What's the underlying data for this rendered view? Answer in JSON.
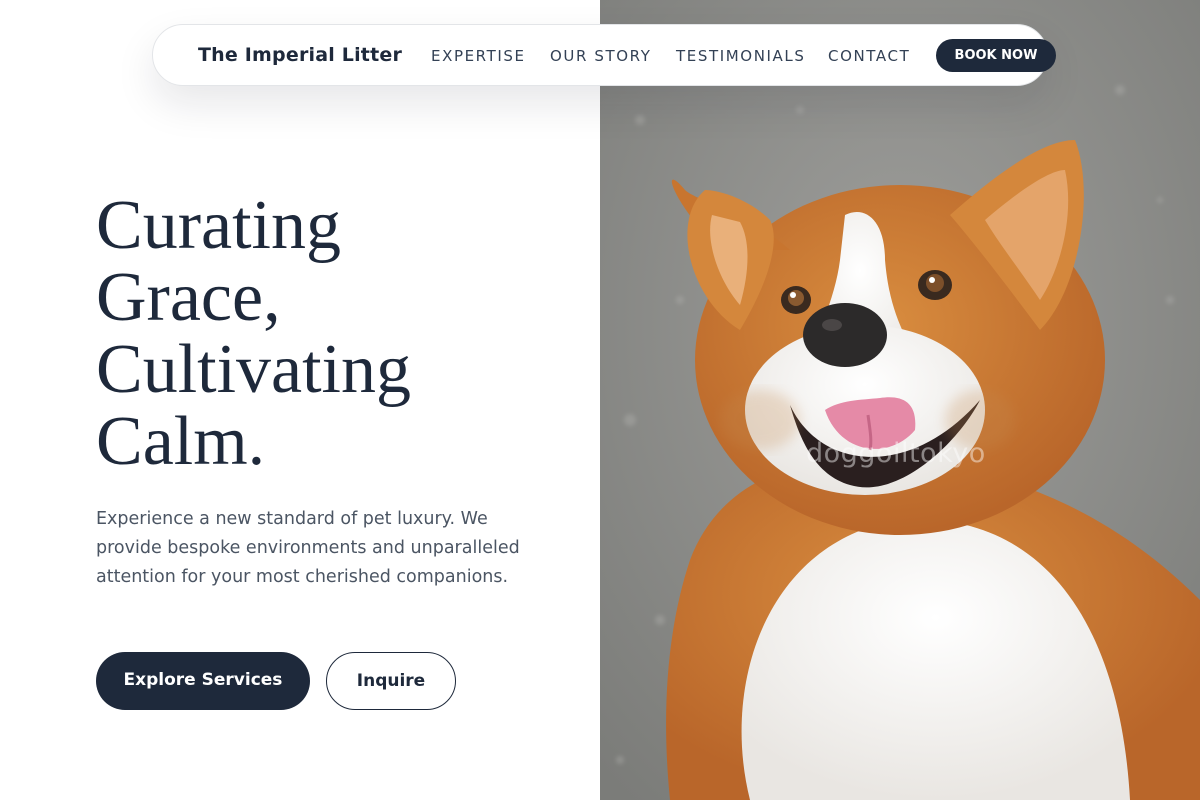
{
  "nav": {
    "brand": "The Imperial Litter",
    "links": [
      "EXPERTISE",
      "OUR STORY",
      "TESTIMONIALS",
      "CONTACT"
    ],
    "cta": "BOOK NOW"
  },
  "hero": {
    "title_lines": [
      "Curating",
      "Grace,",
      "Cultivating",
      "Calm."
    ],
    "description": "Experience a new standard of pet luxury. We provide bespoke environments and unparalleled attention for your most cherished companions.",
    "primary_button": "Explore Services",
    "secondary_button": "Inquire"
  },
  "photo": {
    "subject": "corgi-dog-photo",
    "watermark": "doggoiltokyo"
  },
  "colors": {
    "navy": "#1e293b",
    "body_text": "#4b5563",
    "background": "#ffffff"
  }
}
